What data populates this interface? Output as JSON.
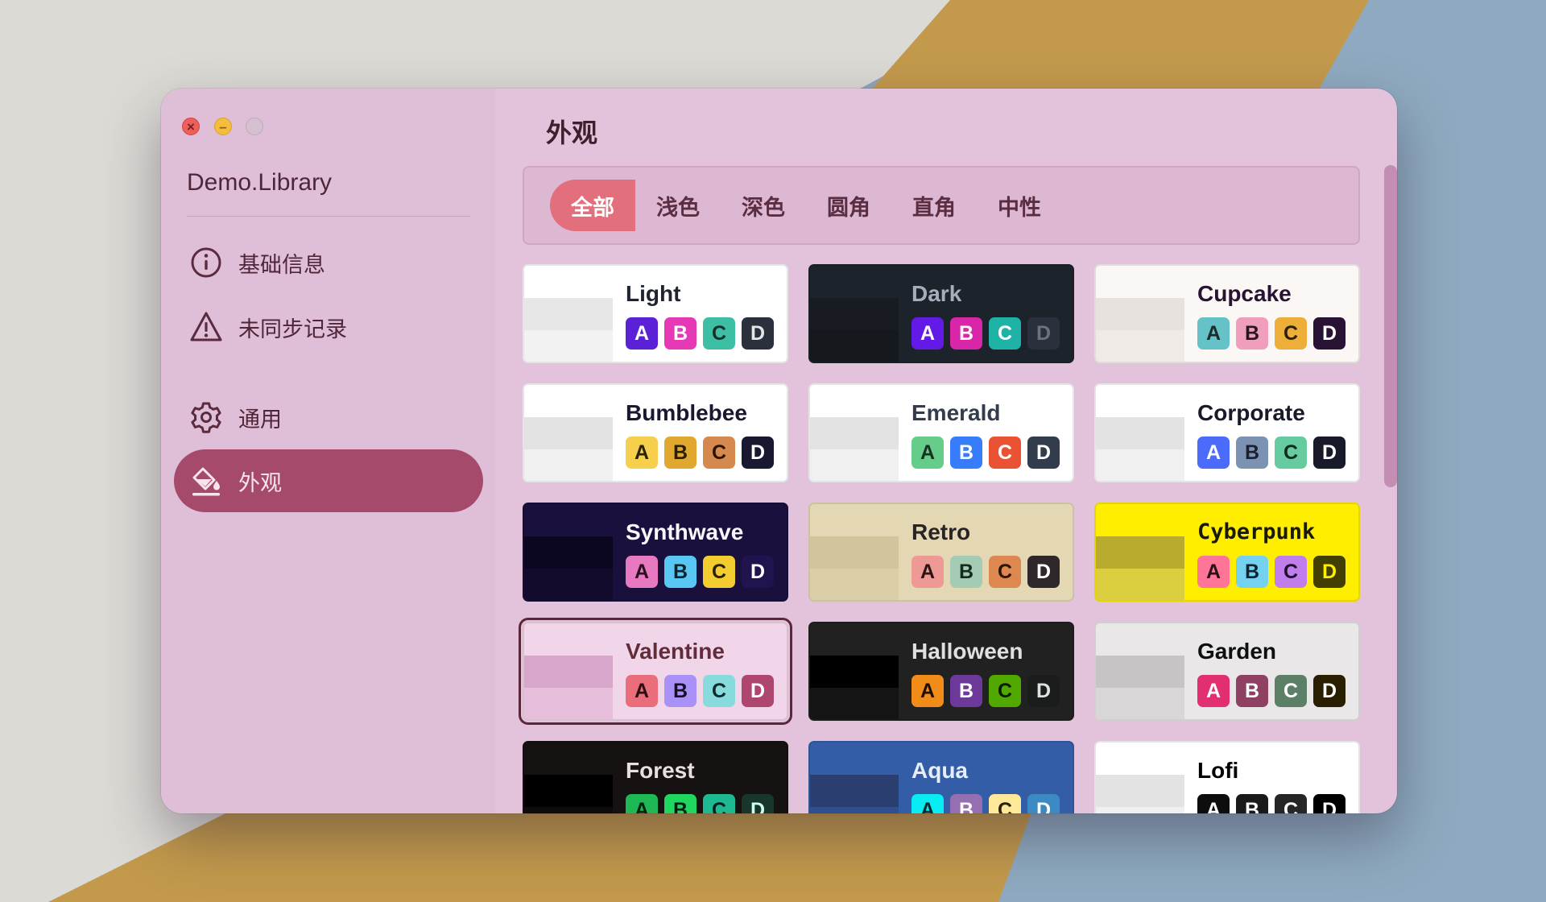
{
  "window": {
    "app_title": "Demo.Library",
    "page_title": "外观"
  },
  "sidebar": {
    "items": [
      {
        "label": "基础信息",
        "icon": "info-circle-icon"
      },
      {
        "label": "未同步记录",
        "icon": "warning-triangle-icon"
      },
      {
        "label": "通用",
        "icon": "gear-icon"
      },
      {
        "label": "外观",
        "icon": "paint-bucket-icon",
        "active": true
      }
    ]
  },
  "filters": {
    "tabs": [
      "全部",
      "浅色",
      "深色",
      "圆角",
      "直角",
      "中性"
    ],
    "active_index": 0
  },
  "themes": [
    {
      "name": "Light",
      "bg": "#ffffff",
      "fg": "#1f2430",
      "strips": [
        "#ffffff",
        "#e7e7e7",
        "#f2f2f2"
      ],
      "swatches": [
        [
          "#5b21d6",
          "#fff"
        ],
        [
          "#e639b6",
          "#fff"
        ],
        [
          "#3dbfa6",
          "#16302a"
        ],
        [
          "#2a303c",
          "#e6e6e6"
        ]
      ]
    },
    {
      "name": "Dark",
      "bg": "#1d232a",
      "fg": "#a6adbb",
      "strips": [
        "#1d232a",
        "#181c22",
        "#15191e"
      ],
      "swatches": [
        [
          "#641ae6",
          "#fff"
        ],
        [
          "#d926a9",
          "#fff"
        ],
        [
          "#1fb2a6",
          "#fff"
        ],
        [
          "#2a303c",
          "#6b7280"
        ]
      ]
    },
    {
      "name": "Cupcake",
      "bg": "#faf7f5",
      "fg": "#291334",
      "strips": [
        "#faf7f5",
        "#e8e2de",
        "#efeae6"
      ],
      "swatches": [
        [
          "#65c3c8",
          "#1e2a2a"
        ],
        [
          "#ef9fbc",
          "#2a1620"
        ],
        [
          "#eeaf3a",
          "#2d1f05"
        ],
        [
          "#291334",
          "#fff"
        ]
      ]
    },
    {
      "name": "Bumblebee",
      "bg": "#ffffff",
      "fg": "#181830",
      "strips": [
        "#ffffff",
        "#e3e3e3",
        "#f0f0f0"
      ],
      "swatches": [
        [
          "#f6d04d",
          "#2a2205"
        ],
        [
          "#e0a82e",
          "#2a1f05"
        ],
        [
          "#d6894f",
          "#2a1505"
        ],
        [
          "#181830",
          "#fff"
        ]
      ]
    },
    {
      "name": "Emerald",
      "bg": "#ffffff",
      "fg": "#333c4d",
      "strips": [
        "#ffffff",
        "#e3e3e3",
        "#f0f0f0"
      ],
      "swatches": [
        [
          "#66cc8a",
          "#173020"
        ],
        [
          "#377cfb",
          "#fff"
        ],
        [
          "#ea5234",
          "#fff"
        ],
        [
          "#333c4d",
          "#fff"
        ]
      ]
    },
    {
      "name": "Corporate",
      "bg": "#ffffff",
      "fg": "#181a2a",
      "strips": [
        "#ffffff",
        "#e3e3e3",
        "#f0f0f0"
      ],
      "swatches": [
        [
          "#4b6bfb",
          "#fff"
        ],
        [
          "#7b92b2",
          "#1a2030"
        ],
        [
          "#67cba0",
          "#102a1e"
        ],
        [
          "#181a2a",
          "#fff"
        ]
      ]
    },
    {
      "name": "Synthwave",
      "bg": "#1a103d",
      "fg": "#f9f7fd",
      "strips": [
        "#1a103d",
        "#0b0720",
        "#130b2b"
      ],
      "swatches": [
        [
          "#e779c1",
          "#2a0f20"
        ],
        [
          "#58c7f3",
          "#0a2430"
        ],
        [
          "#f3cc30",
          "#2a2205"
        ],
        [
          "#20134e",
          "#fff"
        ]
      ]
    },
    {
      "name": "Retro",
      "bg": "#e4d8b4",
      "fg": "#282425",
      "strips": [
        "#e4d8b4",
        "#d2c59d",
        "#dbcfa8"
      ],
      "swatches": [
        [
          "#ef9995",
          "#2a1514"
        ],
        [
          "#a4cbb4",
          "#172a1f"
        ],
        [
          "#dc8850",
          "#2a1505"
        ],
        [
          "#2e282a",
          "#fff"
        ]
      ]
    },
    {
      "name": "Cyberpunk",
      "bg": "#ffee00",
      "fg": "#1a1a00",
      "mono": true,
      "strips": [
        "#ffee00",
        "#b8ab2e",
        "#dbcf40"
      ],
      "swatches": [
        [
          "#ff7598",
          "#2a0f16"
        ],
        [
          "#75d1f0",
          "#0a2430"
        ],
        [
          "#c07eec",
          "#1f0f2a"
        ],
        [
          "#423f00",
          "#ffee00"
        ]
      ]
    },
    {
      "name": "Valentine",
      "bg": "#f0d6e8",
      "fg": "#632c3b",
      "strips": [
        "#f0d6e8",
        "#d9a6cb",
        "#e6bedb"
      ],
      "swatches": [
        [
          "#e96d7b",
          "#2a0f12"
        ],
        [
          "#a991f7",
          "#160f2a"
        ],
        [
          "#88dbdd",
          "#0f2a2a"
        ],
        [
          "#af4670",
          "#fff"
        ]
      ]
    },
    {
      "name": "Halloween",
      "bg": "#212121",
      "fg": "#e0e0e0",
      "strips": [
        "#212121",
        "#000000",
        "#141414"
      ],
      "swatches": [
        [
          "#f28c18",
          "#1a0f00"
        ],
        [
          "#6d3a9c",
          "#fff"
        ],
        [
          "#51a800",
          "#0a1a00"
        ],
        [
          "#1b1d1d",
          "#e0e0e0"
        ]
      ]
    },
    {
      "name": "Garden",
      "bg": "#e9e7e7",
      "fg": "#100f0f",
      "strips": [
        "#e9e7e7",
        "#c6c4c4",
        "#d8d6d6"
      ],
      "swatches": [
        [
          "#e12f72",
          "#fff"
        ],
        [
          "#8e4162",
          "#fff"
        ],
        [
          "#5c7f67",
          "#fff"
        ],
        [
          "#291e00",
          "#fff"
        ]
      ]
    },
    {
      "name": "Forest",
      "bg": "#171212",
      "fg": "#e8e0e0",
      "strips": [
        "#171212",
        "#000000",
        "#0e0b0b"
      ],
      "swatches": [
        [
          "#1eb854",
          "#05200f"
        ],
        [
          "#1fd65f",
          "#05200f"
        ],
        [
          "#1db990",
          "#052018"
        ],
        [
          "#19362d",
          "#cfe"
        ]
      ]
    },
    {
      "name": "Aqua",
      "bg": "#345da7",
      "fg": "#e6eefc",
      "strips": [
        "#345da7",
        "#2a3f70",
        "#304f8c"
      ],
      "swatches": [
        [
          "#09ecf3",
          "#05282a"
        ],
        [
          "#966fb3",
          "#fff"
        ],
        [
          "#ffe999",
          "#2a2205"
        ],
        [
          "#3b8ac4",
          "#fff"
        ]
      ]
    },
    {
      "name": "Lofi",
      "bg": "#ffffff",
      "fg": "#000000",
      "strips": [
        "#ffffff",
        "#e3e3e3",
        "#f0f0f0"
      ],
      "swatches": [
        [
          "#0d0d0d",
          "#fff"
        ],
        [
          "#1a1919",
          "#fff"
        ],
        [
          "#262626",
          "#fff"
        ],
        [
          "#000000",
          "#fff"
        ]
      ]
    }
  ],
  "swatch_letters": [
    "A",
    "B",
    "C",
    "D"
  ]
}
